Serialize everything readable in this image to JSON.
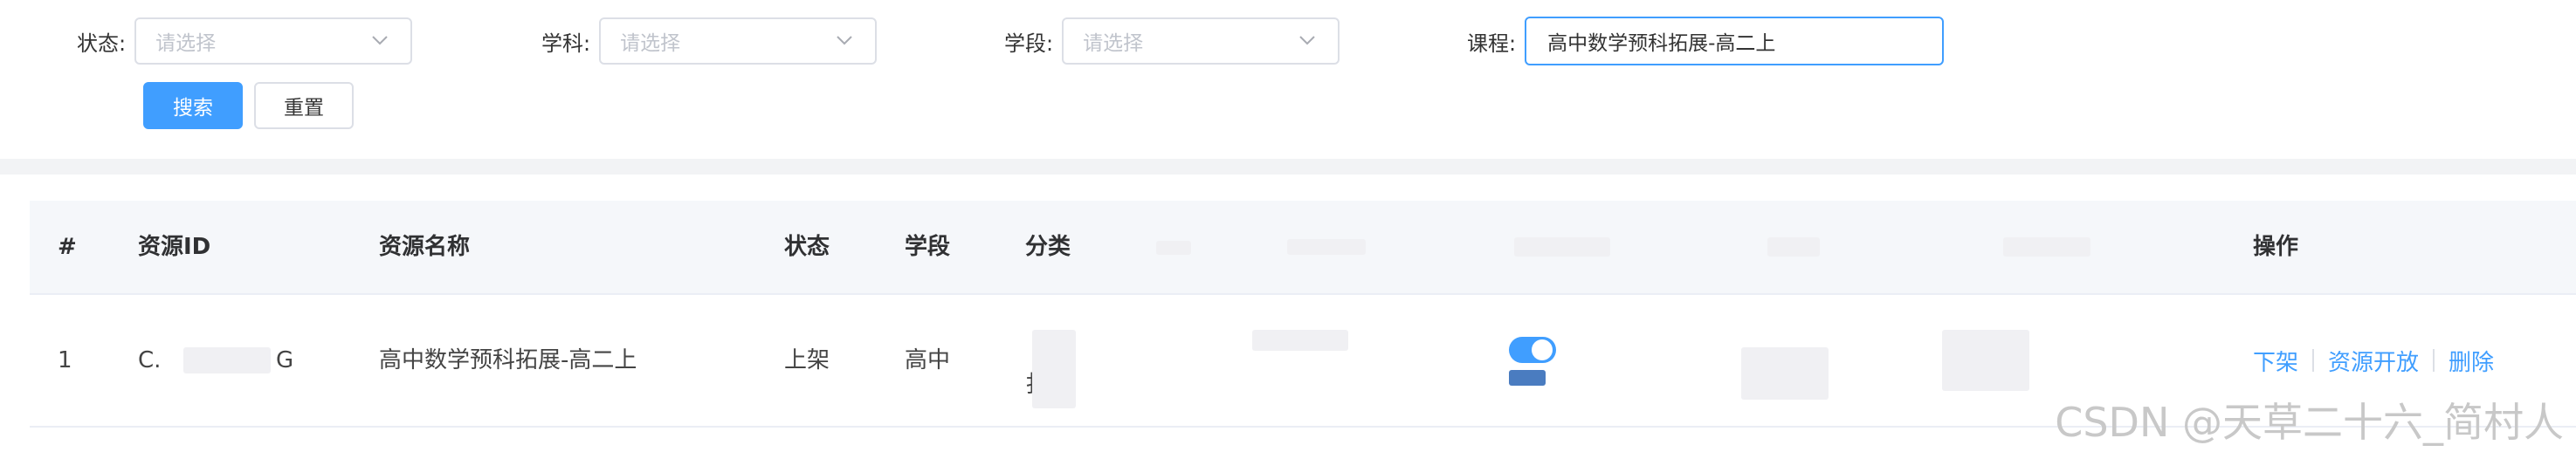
{
  "filters": {
    "status": {
      "label": "状态:",
      "placeholder": "请选择"
    },
    "subject": {
      "label": "学科:",
      "placeholder": "请选择"
    },
    "stage": {
      "label": "学段:",
      "placeholder": "请选择"
    },
    "course": {
      "label": "课程:",
      "value": "高中数学预科拓展-高二上"
    }
  },
  "buttons": {
    "search": "搜索",
    "reset": "重置"
  },
  "table": {
    "headers": {
      "index": "#",
      "resource_id": "资源ID",
      "name": "资源名称",
      "status": "状态",
      "stage": "学段",
      "category": "分类",
      "actions": "操作"
    },
    "rows": [
      {
        "index": "1",
        "resource_id_start": "C.",
        "resource_id_end": "G",
        "name": "高中数学预科拓展-高二上",
        "status": "上架",
        "stage": "高中",
        "category_line1": "",
        "category_line2": "扌",
        "toggle_on": true
      }
    ],
    "actions": {
      "offline": "下架",
      "open": "资源开放",
      "delete": "删除"
    }
  },
  "watermark": "CSDN @天草二十六_简村人",
  "colors": {
    "primary": "#409eff",
    "border": "#dcdfe6",
    "header_bg": "#f5f7fa"
  },
  "icons": {
    "select_arrow": "chevron-down-icon"
  }
}
